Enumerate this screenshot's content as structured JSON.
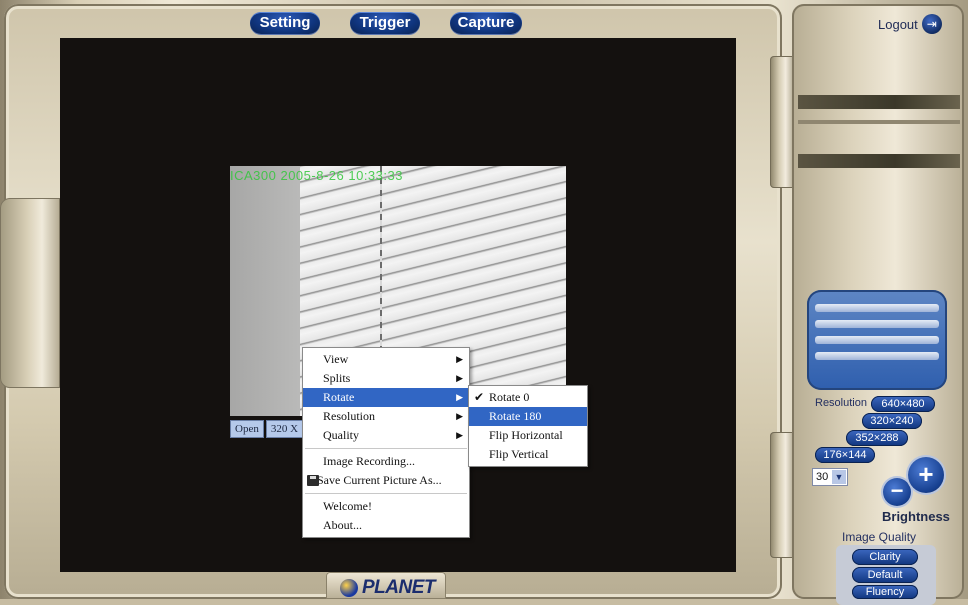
{
  "toolbar": {
    "setting_label": "Setting",
    "trigger_label": "Trigger",
    "capture_label": "Capture",
    "logout_label": "Logout"
  },
  "video": {
    "overlay_text": "ICA300  2005-8-26  10:33:33",
    "status_open": "Open",
    "status_res": "320 X"
  },
  "context_menu": {
    "items": [
      {
        "label": "View",
        "submenu": true
      },
      {
        "label": "Splits",
        "submenu": true
      },
      {
        "label": "Rotate",
        "submenu": true,
        "highlighted": true
      },
      {
        "label": "Resolution",
        "submenu": true
      },
      {
        "label": "Quality",
        "submenu": true
      },
      {
        "label": "Image Recording..."
      },
      {
        "label": "Save Current Picture As...",
        "icon": "floppy-disk-icon"
      },
      {
        "label": "Welcome!"
      },
      {
        "label": "About..."
      }
    ]
  },
  "rotate_submenu": {
    "items": [
      {
        "label": "Rotate 0",
        "checked": true
      },
      {
        "label": "Rotate 180",
        "highlighted": true
      },
      {
        "label": "Flip Horizontal"
      },
      {
        "label": "Flip Vertical"
      }
    ]
  },
  "controls": {
    "resolution_label": "Resolution",
    "resolutions": [
      "640×480",
      "320×240",
      "352×288",
      "176×144"
    ],
    "fps_value": "30",
    "brightness_label": "Brightness",
    "minus": "−",
    "plus": "+",
    "image_quality_label": "Image Quality",
    "quality_options": [
      "Clarity",
      "Default",
      "Fluency"
    ]
  },
  "brand": {
    "logo_text": "PLANET"
  },
  "colors": {
    "accent": "#10357e",
    "menu_highlight": "#3166c4",
    "overlay_green": "#33c63b"
  }
}
